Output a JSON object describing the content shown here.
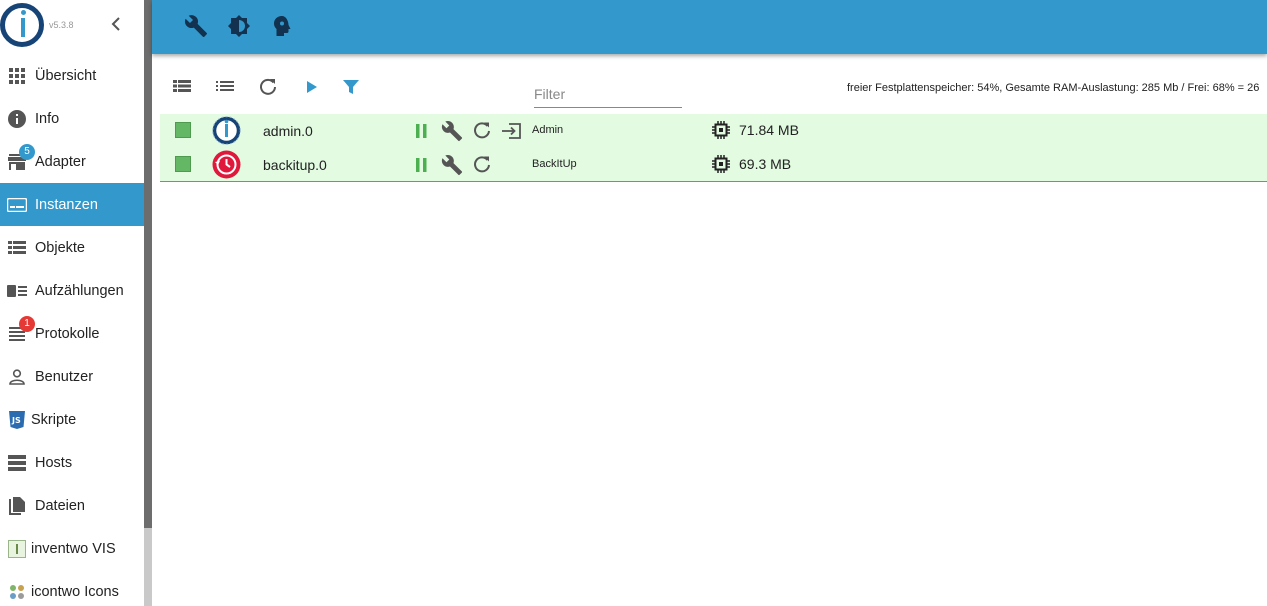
{
  "app": {
    "version": "v5.3.8"
  },
  "sidebar": {
    "items": [
      {
        "label": "Übersicht",
        "icon": "grid-icon"
      },
      {
        "label": "Info",
        "icon": "info-icon"
      },
      {
        "label": "Adapter",
        "icon": "store-icon",
        "badge": "5"
      },
      {
        "label": "Instanzen",
        "icon": "instances-icon",
        "active": true
      },
      {
        "label": "Objekte",
        "icon": "list-icon"
      },
      {
        "label": "Aufzählungen",
        "icon": "enum-icon"
      },
      {
        "label": "Protokolle",
        "icon": "log-icon",
        "badge": "1"
      },
      {
        "label": "Benutzer",
        "icon": "user-icon"
      },
      {
        "label": "Skripte",
        "icon": "js-icon"
      },
      {
        "label": "Hosts",
        "icon": "hosts-icon"
      },
      {
        "label": "Dateien",
        "icon": "files-icon"
      },
      {
        "label": "inventwo VIS",
        "icon": "inventwo-icon"
      },
      {
        "label": "icontwo Icons",
        "icon": "icontwo-icon"
      }
    ]
  },
  "toolbar": {
    "filter_placeholder": "Filter",
    "status": "freier Festplattenspeicher: 54%, Gesamte RAM-Auslastung: 285 Mb / Frei: 68% = 26"
  },
  "instances": [
    {
      "name": "admin.0",
      "title": "Admin",
      "memory": "71.84 MB",
      "status_color": "#64b764"
    },
    {
      "name": "backitup.0",
      "title": "BackItUp",
      "memory": "69.3 MB",
      "status_color": "#64b764"
    }
  ],
  "colors": {
    "accent": "#3399cc",
    "row_bg": "#e2fbe1",
    "running": "#4caf50"
  }
}
